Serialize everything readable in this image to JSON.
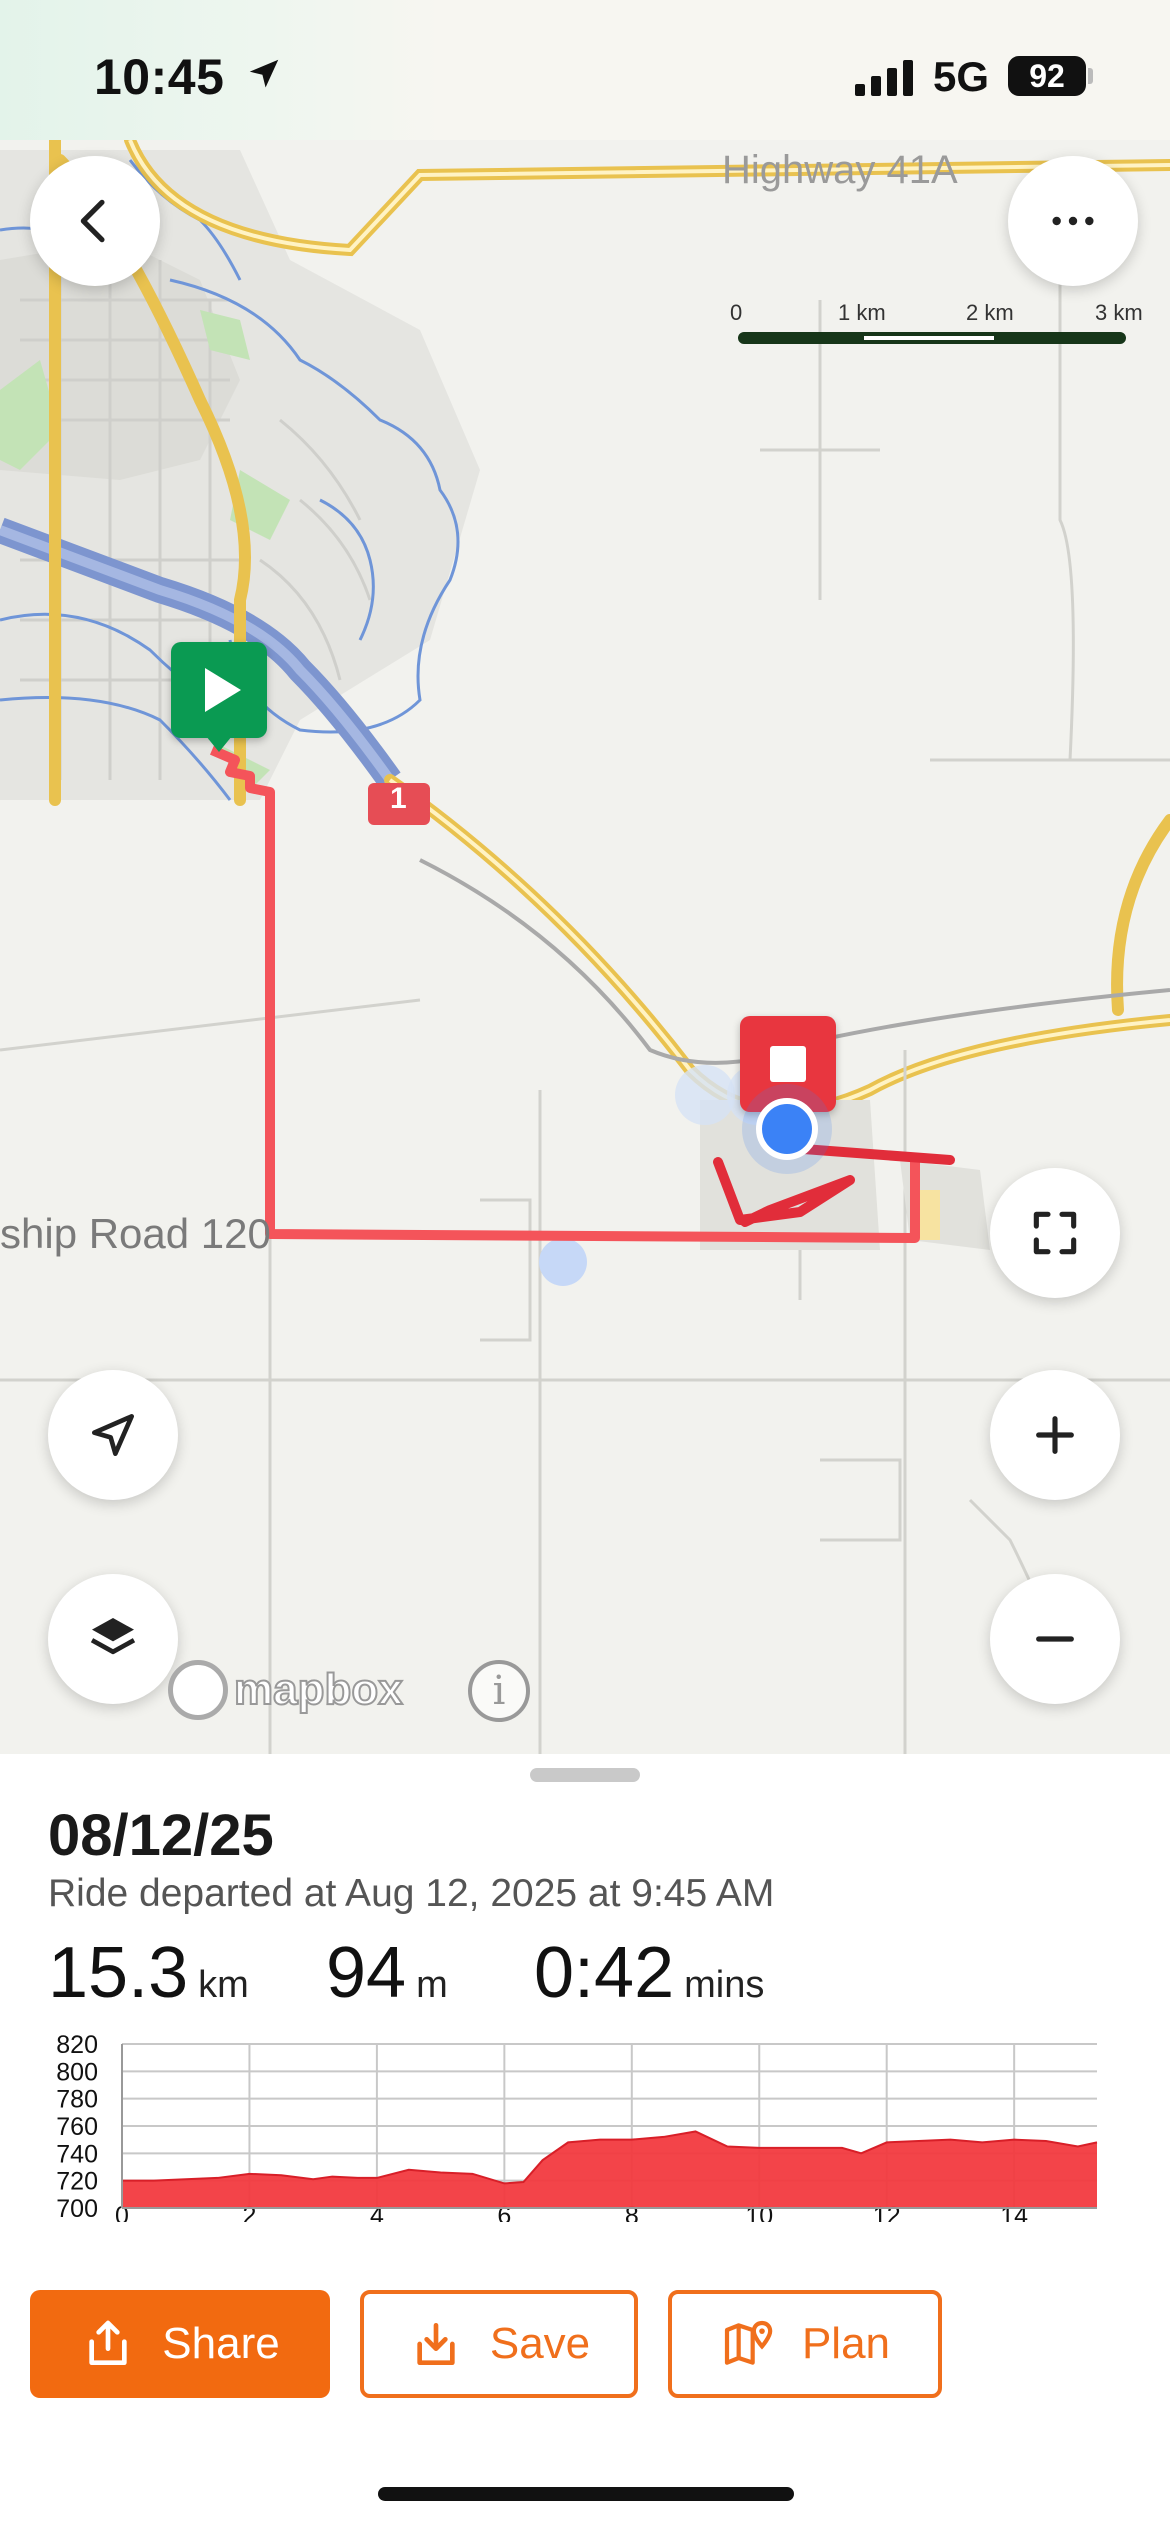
{
  "status_bar": {
    "time": "10:45",
    "network": "5G",
    "battery": "92",
    "location_icon": "location-arrow-icon",
    "signal_icon": "signal-bars-icon"
  },
  "map": {
    "highway_label": "Highway 41A",
    "road_label": "ship Road 120",
    "route_shield": "1",
    "scale_labels": [
      "0",
      "1 km",
      "2 km",
      "3 km"
    ],
    "attribution": "mapbox",
    "info_label": "i",
    "colors": {
      "route": "#f4545a",
      "start_marker": "#0a9a52",
      "end_marker": "#e8363f",
      "user_dot": "#3b82f6",
      "water": "#7d9bd6",
      "highway": "#f2c94c"
    }
  },
  "controls": {
    "back": "chevron-left-icon",
    "more": "more-horizontal-icon",
    "fullscreen": "fullscreen-icon",
    "locate": "navigation-arrow-icon",
    "zoom_in": "plus-icon",
    "zoom_out": "minus-icon",
    "layers": "layers-icon"
  },
  "ride": {
    "date": "08/12/25",
    "subtitle": "Ride departed at Aug 12, 2025 at 9:45 AM",
    "distance": {
      "value": "15.3",
      "unit": "km"
    },
    "elevation": {
      "value": "94",
      "unit": "m"
    },
    "duration": {
      "value": "0:42",
      "unit": "mins"
    }
  },
  "chart_data": {
    "type": "area",
    "xlabel": "",
    "ylabel": "",
    "xlim": [
      0,
      15.3
    ],
    "ylim": [
      700,
      820
    ],
    "x_ticks": [
      "0",
      "2",
      "4",
      "6",
      "8",
      "10",
      "12",
      "14"
    ],
    "y_ticks": [
      "820",
      "800",
      "780",
      "760",
      "740",
      "720",
      "700"
    ],
    "grid": true,
    "color": "#f23a3f",
    "x": [
      0,
      0.5,
      1,
      1.5,
      2,
      2.5,
      3,
      3.3,
      3.7,
      4,
      4.5,
      5,
      5.5,
      6,
      6.3,
      6.6,
      7,
      7.5,
      8,
      8.5,
      9,
      9.5,
      10,
      10.5,
      11,
      11.3,
      11.6,
      12,
      12.5,
      13,
      13.5,
      14,
      14.5,
      15,
      15.3
    ],
    "y": [
      720,
      720,
      721,
      722,
      725,
      724,
      721,
      723,
      722,
      722,
      728,
      726,
      725,
      718,
      719,
      735,
      748,
      750,
      750,
      752,
      756,
      745,
      744,
      744,
      744,
      744,
      740,
      748,
      749,
      750,
      748,
      750,
      749,
      745,
      748
    ]
  },
  "actions": {
    "share": "Share",
    "save": "Save",
    "plan": "Plan",
    "share_icon": "share-icon",
    "save_icon": "download-icon",
    "plan_icon": "map-pin-icon"
  }
}
